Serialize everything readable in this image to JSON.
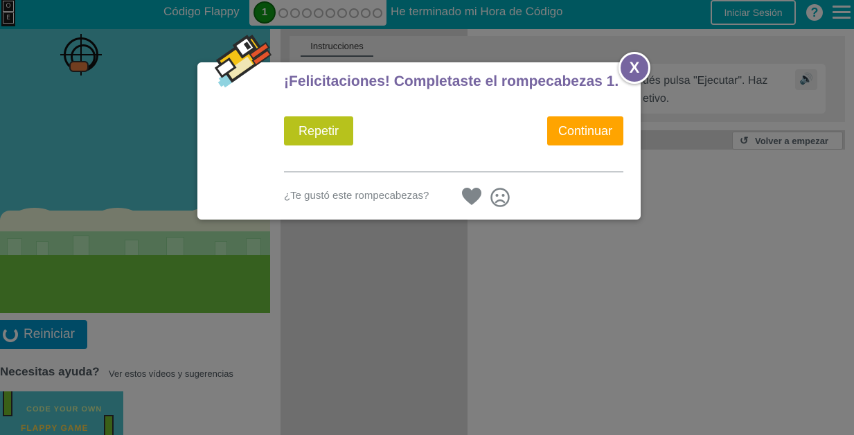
{
  "header": {
    "logo_letters": [
      "O",
      "E"
    ],
    "app_title": "Código Flappy",
    "current_puzzle": "1",
    "puzzle_count": 10,
    "finished_link": "He terminado mi Hora de Código",
    "signin_label": "Iniciar Sesión",
    "help_icon": "?",
    "colors": {
      "bar": "#00adbc",
      "current": "#0e9e16"
    }
  },
  "game": {
    "reset_label": "Reiniciar",
    "help_title": "Necesitas ayuda?",
    "help_subtitle": "Ver estos vídeos y sugerencias",
    "video_title_1": "CODE YOUR OWN",
    "video_title_2": "FLAPPY GAME"
  },
  "instructions": {
    "tab_label": "Instrucciones",
    "text_line_1": "ués pulsa \"Ejecutar\". Haz",
    "text_line_2": "etivo.",
    "start_over_label": "Volver a empezar"
  },
  "dialog": {
    "title": "¡Felicitaciones! Completaste el rompecabezas 1.",
    "repeat_label": "Repetir",
    "continue_label": "Continuar",
    "feedback_question": "¿Te gustó este rompecabezas?",
    "close_label": "X",
    "icons": [
      "heart-icon",
      "sad-face-icon",
      "flappy-bird-icon"
    ],
    "colors": {
      "title": "#7665a0",
      "repeat": "#b7c21c",
      "continue": "#ffa400"
    }
  }
}
